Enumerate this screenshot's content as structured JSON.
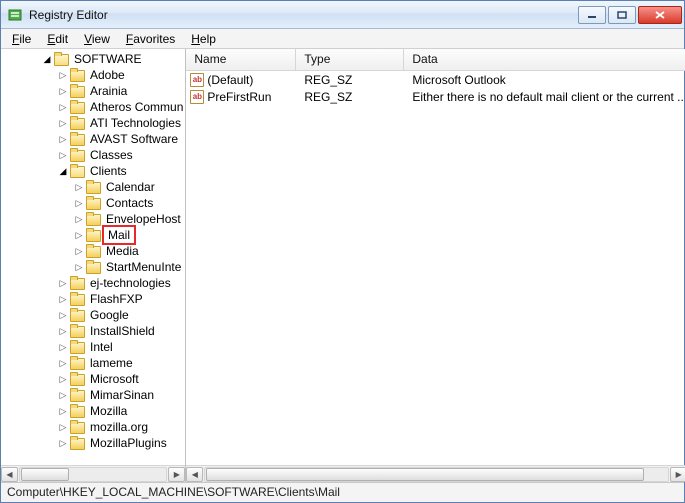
{
  "window": {
    "title": "Registry Editor"
  },
  "menu": {
    "file": "File",
    "edit": "Edit",
    "view": "View",
    "favorites": "Favorites",
    "help": "Help"
  },
  "columns": {
    "name": "Name",
    "type": "Type",
    "data": "Data"
  },
  "tree": {
    "root": "SOFTWARE",
    "items": [
      "Adobe",
      "Arainia",
      "Atheros Commun",
      "ATI Technologies",
      "AVAST Software",
      "Classes"
    ],
    "clients": "Clients",
    "clients_children": [
      "Calendar",
      "Contacts",
      "EnvelopeHost",
      "Mail",
      "Media",
      "StartMenuInte"
    ],
    "after_clients": [
      "ej-technologies",
      "FlashFXP",
      "Google",
      "InstallShield",
      "Intel",
      "lameme",
      "Microsoft",
      "MimarSinan",
      "Mozilla",
      "mozilla.org",
      "MozillaPlugins"
    ]
  },
  "rows": [
    {
      "name": "(Default)",
      "type": "REG_SZ",
      "data": "Microsoft Outlook"
    },
    {
      "name": "PreFirstRun",
      "type": "REG_SZ",
      "data": "Either there is no default mail client or the current ..."
    }
  ],
  "icons": {
    "value_glyph": "ab"
  },
  "statusbar": {
    "path": "Computer\\HKEY_LOCAL_MACHINE\\SOFTWARE\\Clients\\Mail"
  }
}
